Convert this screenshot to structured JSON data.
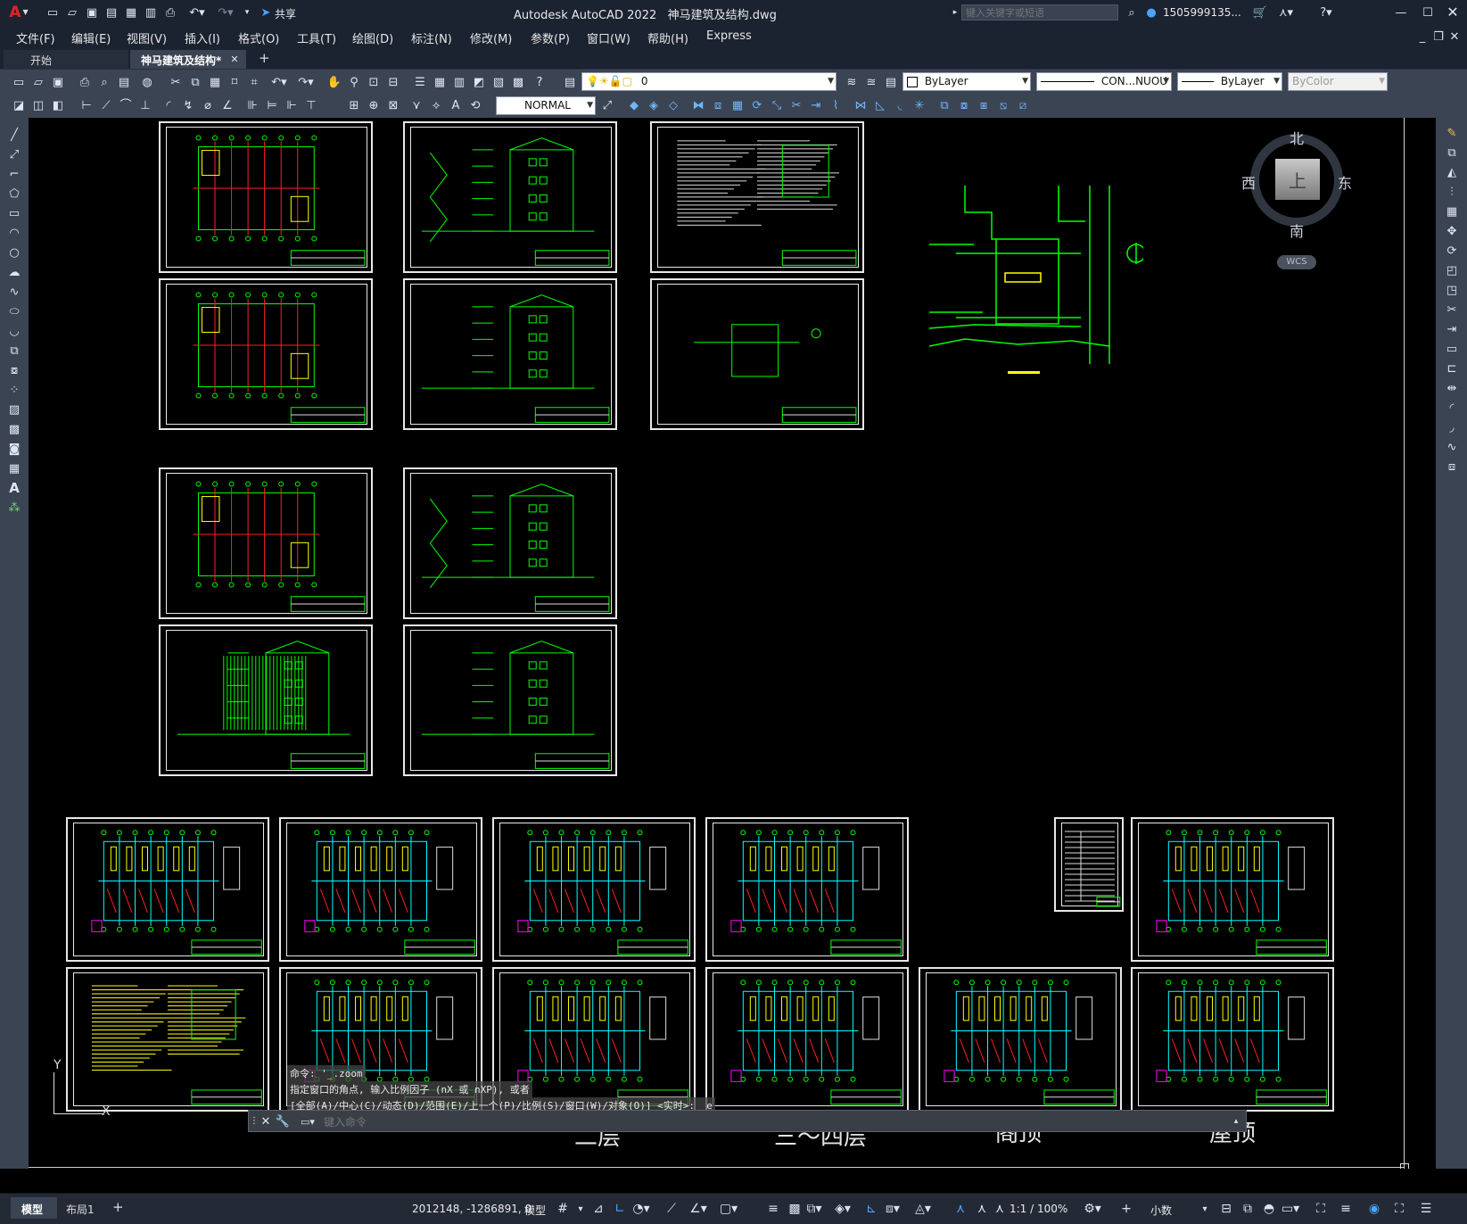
{
  "app": {
    "title": "Autodesk AutoCAD 2022",
    "document": "神马建筑及结构.dwg",
    "search_placeholder": "键入关键字或短语",
    "user": "1505999135...",
    "share_label": "共享"
  },
  "menu": [
    "文件(F)",
    "编辑(E)",
    "视图(V)",
    "插入(I)",
    "格式(O)",
    "工具(T)",
    "绘图(D)",
    "标注(N)",
    "修改(M)",
    "参数(P)",
    "窗口(W)",
    "帮助(H)",
    "Express"
  ],
  "tabs": {
    "start": "开始",
    "active": "神马建筑及结构*",
    "add": "+"
  },
  "properties": {
    "layer": "0",
    "color": "ByLayer",
    "linetype": "CON...NUOU",
    "lineweight": "ByLayer",
    "plotstyle": "ByColor",
    "dimstyle": "NORMAL"
  },
  "viewcube": {
    "north": "北",
    "south": "南",
    "east": "东",
    "west": "西",
    "face": "上",
    "wcs": "WCS"
  },
  "ucs": {
    "y": "Y",
    "x": "X"
  },
  "floor_labels": [
    "二层",
    "三～四层",
    "阁顶",
    "屋顶"
  ],
  "command": {
    "history_1": "命令: '_.zoom",
    "history_2": "指定窗口的角点, 输入比例因子 (nX 或 nXP), 或者",
    "history_3": "[全部(A)/中心(C)/动态(D)/范围(E)/上一个(P)/比例(S)/窗口(W)/对象(O)] <实时>: _e",
    "placeholder": "键入命令"
  },
  "status": {
    "model_tab": "模型",
    "layout_tab": "布局1",
    "add": "+",
    "coords": "2012148, -1286891, 0",
    "space": "模型",
    "scale": "1:1 / 100%",
    "units": "小数"
  },
  "colors": {
    "drawing_green": "#00ff00",
    "drawing_red": "#ff2020",
    "drawing_yellow": "#ffff00",
    "drawing_cyan": "#00ffff",
    "drawing_magenta": "#ff00ff",
    "ui_dark": "#1b2230",
    "ui_toolbar": "#3b4453",
    "accent_blue": "#4aa3ff"
  }
}
